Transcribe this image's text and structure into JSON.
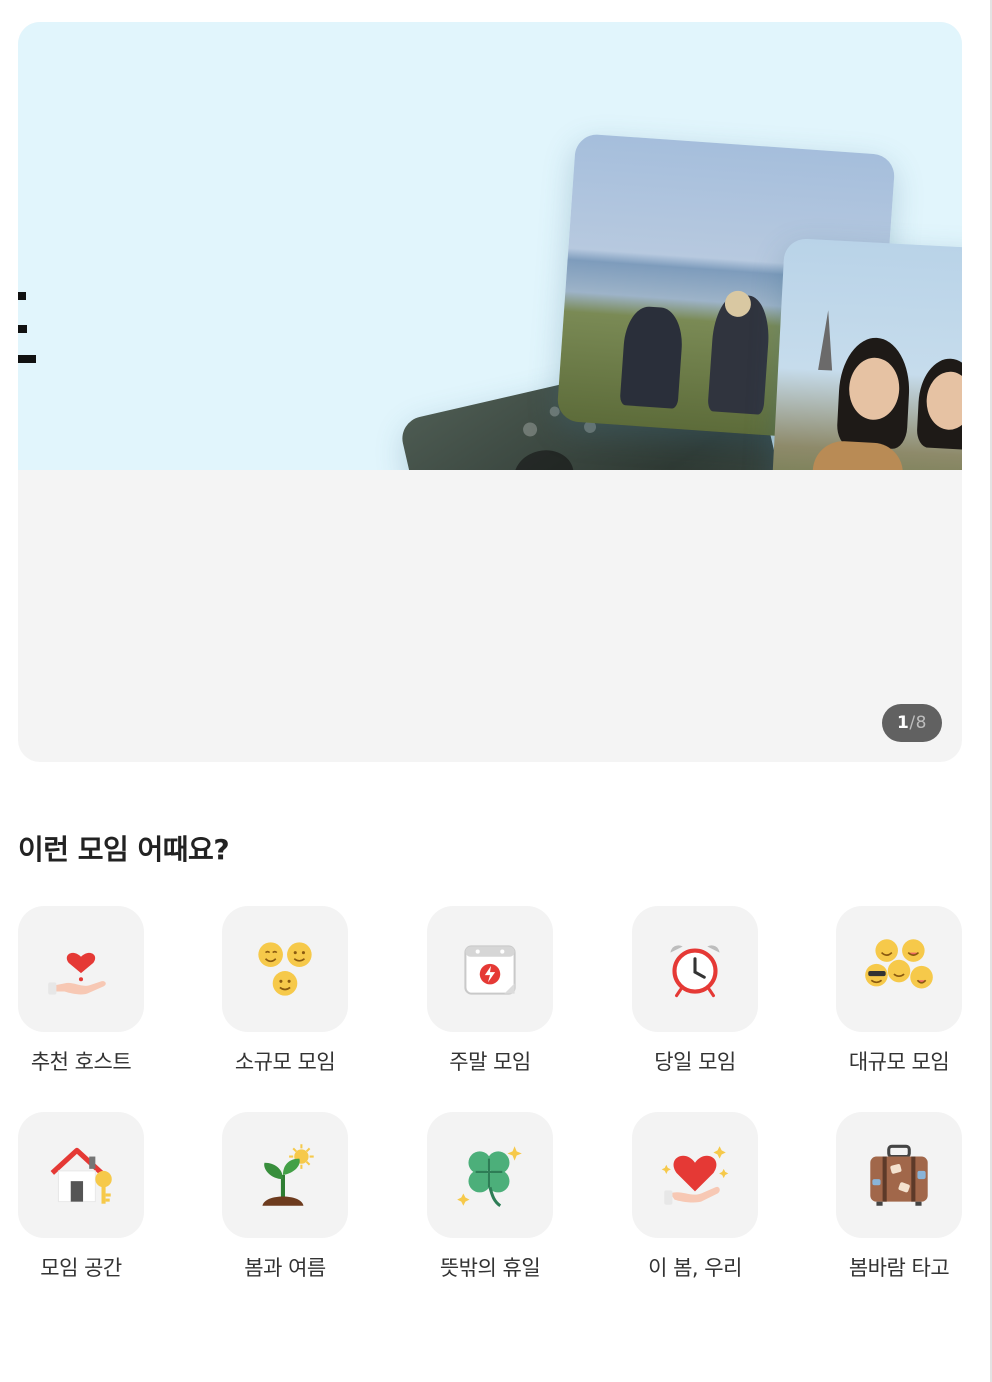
{
  "banner": {
    "pager": {
      "current": "1",
      "total": "/8"
    }
  },
  "section": {
    "title": "이런 모임 어때요?",
    "items": [
      {
        "label": "추천 호스트",
        "icon": "heart-hand-icon"
      },
      {
        "label": "소규모 모임",
        "icon": "three-smiles-icon"
      },
      {
        "label": "주말 모임",
        "icon": "calendar-bolt-icon"
      },
      {
        "label": "당일 모임",
        "icon": "alarm-clock-icon"
      },
      {
        "label": "대규모 모임",
        "icon": "many-emoji-icon"
      },
      {
        "label": "모임 공간",
        "icon": "house-key-icon"
      },
      {
        "label": "봄과 여름",
        "icon": "sprout-sun-icon"
      },
      {
        "label": "뜻밖의 휴일",
        "icon": "four-leaf-clover-icon"
      },
      {
        "label": "이 봄, 우리",
        "icon": "heart-in-hand-sparkle-icon"
      },
      {
        "label": "봄바람 타고",
        "icon": "suitcase-icon"
      }
    ]
  },
  "colors": {
    "bannerSky": "#e1f5fc",
    "bannerBottom": "#f4f4f4",
    "pagerBg": "#616161",
    "tileBg": "#f3f3f3"
  }
}
